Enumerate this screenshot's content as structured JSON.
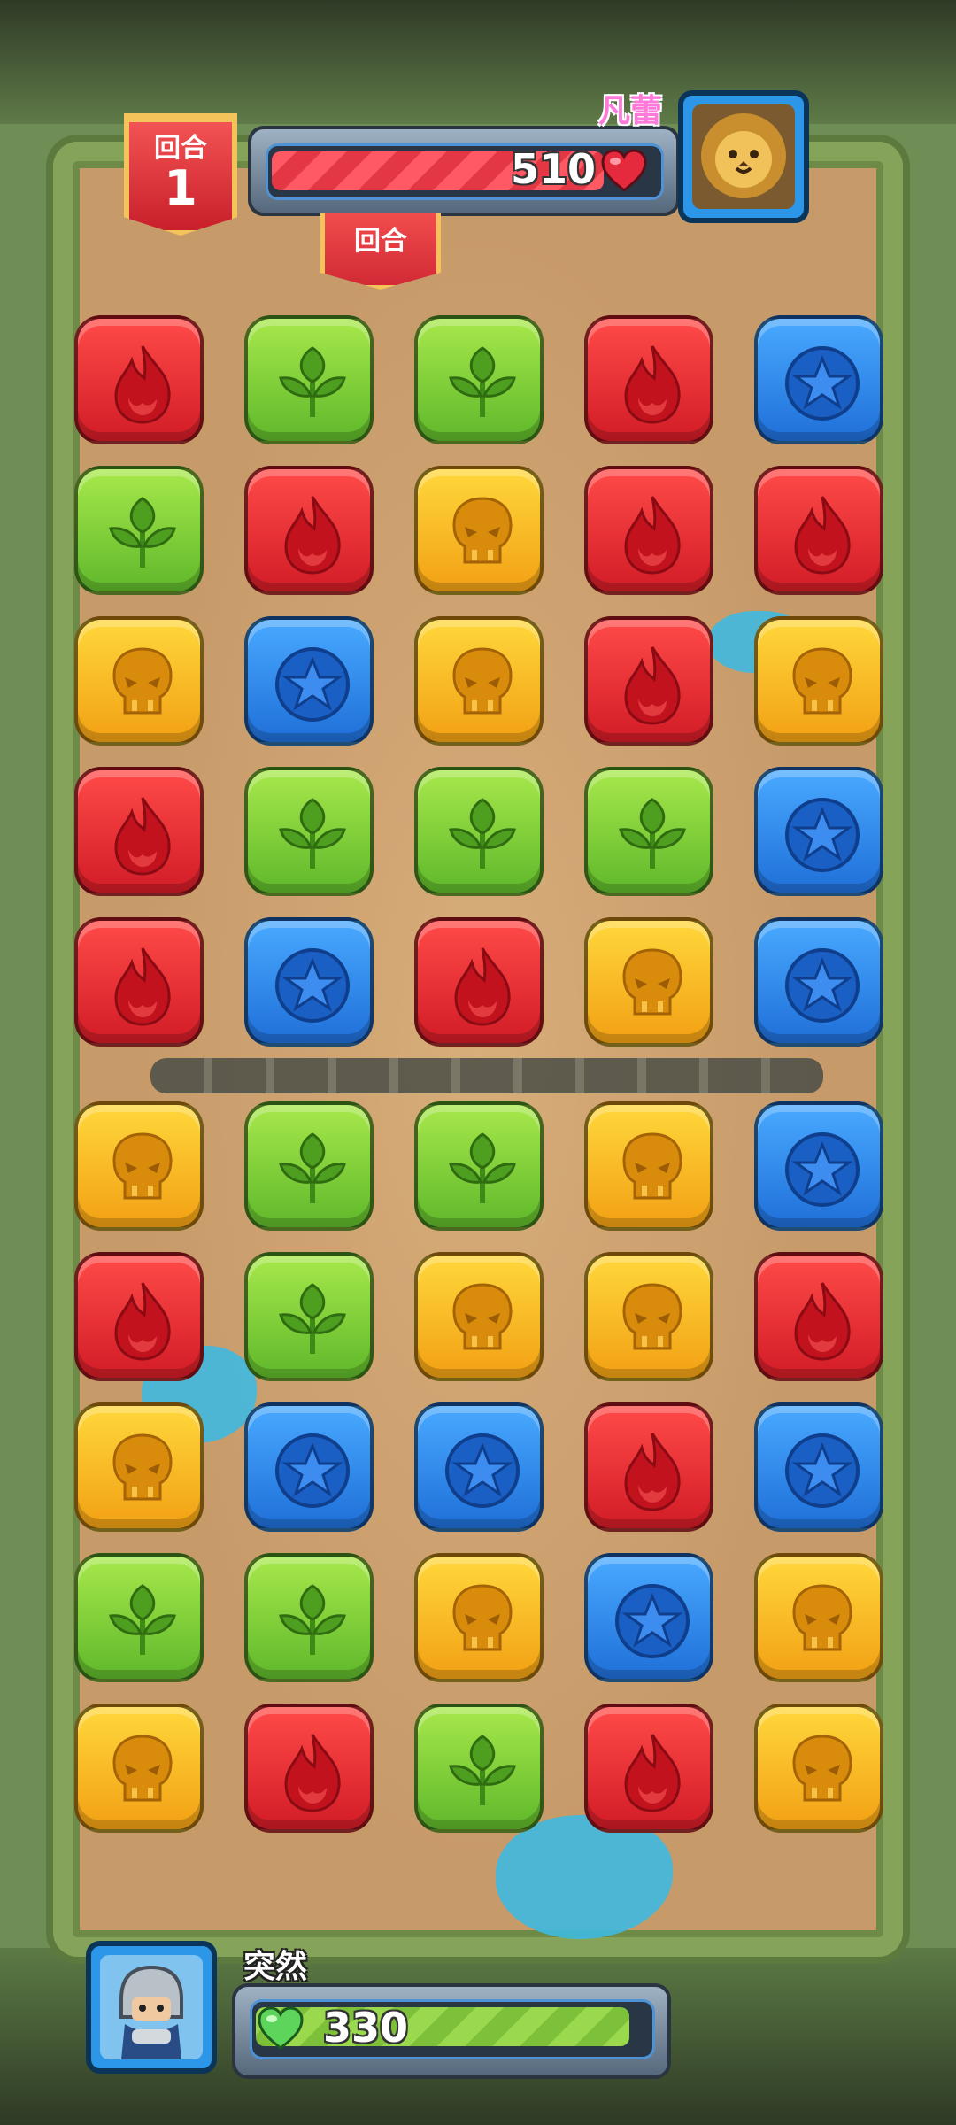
{
  "enemy": {
    "name": "凡蕾",
    "hp": "510",
    "hp_fraction": 0.86,
    "portrait_icon": "lion-icon"
  },
  "player": {
    "name": "突然",
    "hp": "330",
    "hp_fraction": 0.95,
    "portrait_icon": "knight-icon"
  },
  "round": {
    "label": "回合",
    "number": "1",
    "tab_label": "回合"
  },
  "colors": {
    "fire": "#e0262f",
    "leaf": "#7ccb33",
    "skull": "#f6b21d",
    "star": "#2f86e8"
  },
  "board": {
    "rows": [
      [
        "fire",
        "leaf",
        "leaf",
        "fire",
        "star"
      ],
      [
        "leaf",
        "fire",
        "skull",
        "fire",
        "fire"
      ],
      [
        "skull",
        "star",
        "skull",
        "fire",
        "skull"
      ],
      [
        "fire",
        "leaf",
        "leaf",
        "leaf",
        "star"
      ],
      [
        "fire",
        "star",
        "fire",
        "skull",
        "star"
      ],
      [
        "skull",
        "leaf",
        "leaf",
        "skull",
        "star"
      ],
      [
        "fire",
        "leaf",
        "skull",
        "skull",
        "fire"
      ],
      [
        "skull",
        "star",
        "star",
        "fire",
        "star"
      ],
      [
        "leaf",
        "leaf",
        "skull",
        "star",
        "skull"
      ],
      [
        "skull",
        "fire",
        "leaf",
        "fire",
        "skull"
      ]
    ]
  }
}
